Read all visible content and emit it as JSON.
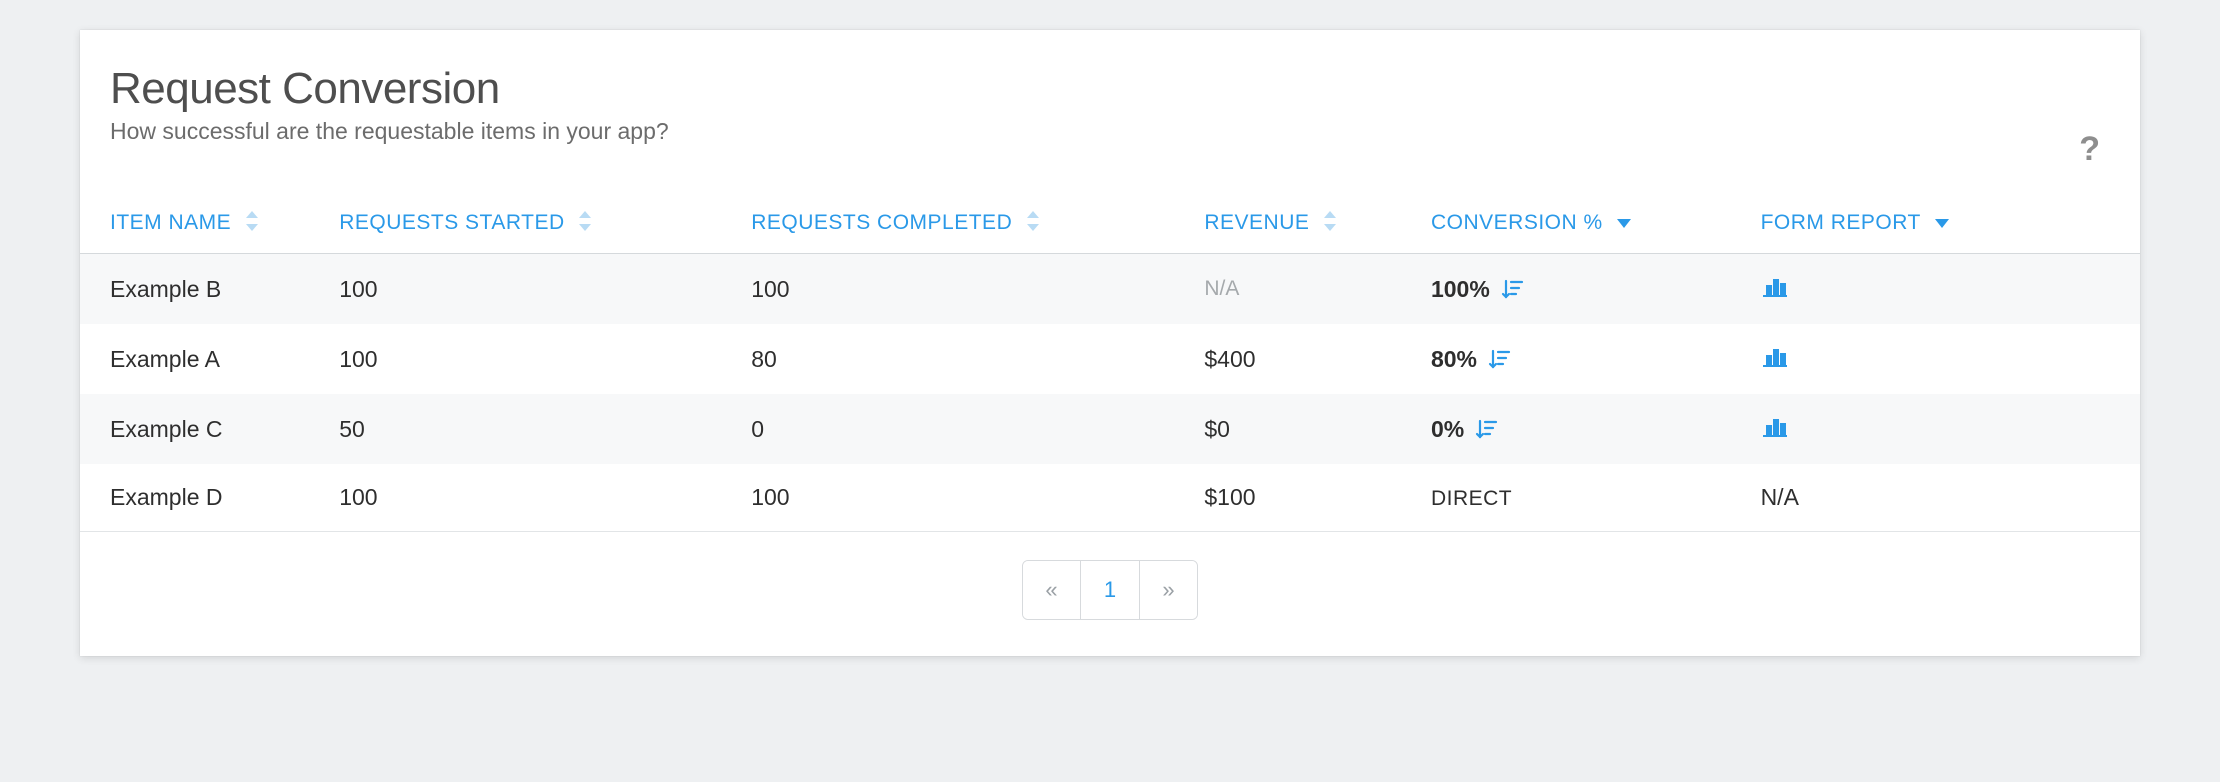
{
  "header": {
    "title": "Request Conversion",
    "subtitle": "How successful are the requestable items in your app?",
    "help_label": "?"
  },
  "columns": {
    "item_name": {
      "label": "ITEM NAME",
      "sort": "both"
    },
    "started": {
      "label": "REQUESTS STARTED",
      "sort": "both"
    },
    "completed": {
      "label": "REQUESTS COMPLETED",
      "sort": "both"
    },
    "revenue": {
      "label": "REVENUE",
      "sort": "both"
    },
    "conversion": {
      "label": "CONVERSION %",
      "sort": "desc"
    },
    "form_report": {
      "label": "FORM REPORT",
      "sort": "desc"
    }
  },
  "rows": [
    {
      "name": "Example B",
      "started": "100",
      "completed": "100",
      "revenue": "N/A",
      "revenue_muted": true,
      "conversion_text": "100%",
      "has_funnel": true,
      "has_chart": true,
      "form_na": ""
    },
    {
      "name": "Example A",
      "started": "100",
      "completed": "80",
      "revenue": "$400",
      "revenue_muted": false,
      "conversion_text": "80%",
      "has_funnel": true,
      "has_chart": true,
      "form_na": ""
    },
    {
      "name": "Example C",
      "started": "50",
      "completed": "0",
      "revenue": "$0",
      "revenue_muted": false,
      "conversion_text": "0%",
      "has_funnel": true,
      "has_chart": true,
      "form_na": ""
    },
    {
      "name": "Example D",
      "started": "100",
      "completed": "100",
      "revenue": "$100",
      "revenue_muted": false,
      "conversion_text": "DIRECT",
      "has_funnel": false,
      "has_chart": false,
      "form_na": "N/A"
    }
  ],
  "pagination": {
    "current_page": "1",
    "prev_label": "«",
    "next_label": "»"
  },
  "chart_data": {
    "type": "table",
    "title": "Request Conversion",
    "columns": [
      "Item Name",
      "Requests Started",
      "Requests Completed",
      "Revenue",
      "Conversion %"
    ],
    "rows": [
      [
        "Example B",
        100,
        100,
        null,
        100
      ],
      [
        "Example A",
        100,
        80,
        400,
        80
      ],
      [
        "Example C",
        50,
        0,
        0,
        0
      ],
      [
        "Example D",
        100,
        100,
        100,
        null
      ]
    ]
  }
}
